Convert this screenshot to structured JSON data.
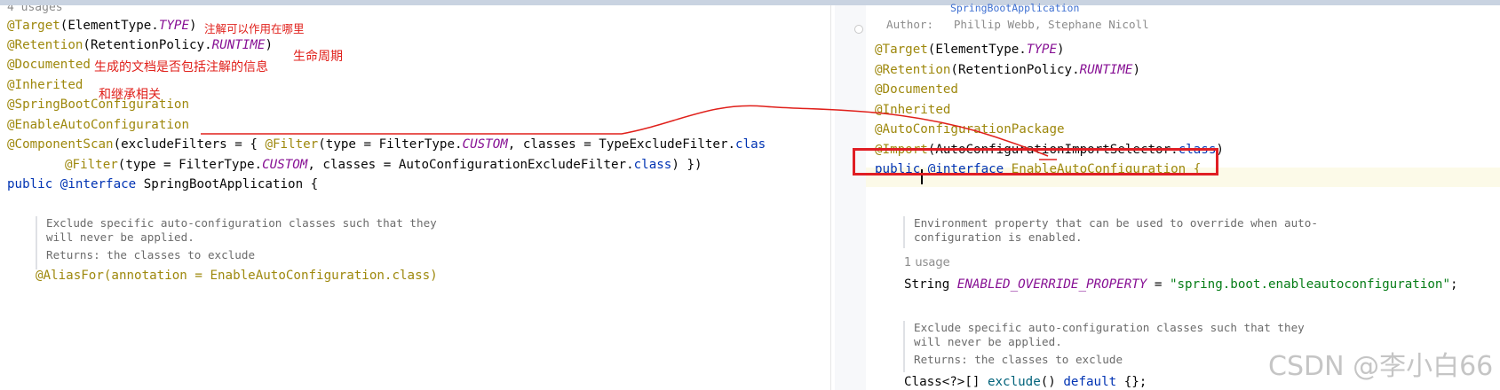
{
  "left": {
    "usages": "4 usages",
    "lines": {
      "target": {
        "ann": "@Target",
        "open": "(ElementType.",
        "const": "TYPE",
        "close": ")"
      },
      "retention": {
        "ann": "@Retention",
        "open": "(RetentionPolicy.",
        "const": "RUNTIME",
        "close": ")"
      },
      "documented": {
        "ann": "@Documented"
      },
      "inherited": {
        "ann": "@Inherited"
      },
      "sba": {
        "ann": "@SpringBootConfiguration"
      },
      "eac": {
        "ann": "@EnableAutoConfiguration"
      },
      "cs1": {
        "ann": "@ComponentScan",
        "a": "(excludeFilters = { ",
        "filter": "@Filter",
        "b": "(type = FilterType.",
        "const": "CUSTOM",
        "c": ", classes = TypeExcludeFilter.",
        "kw": "clas"
      },
      "cs2": {
        "filter": "@Filter",
        "b": "(type = FilterType.",
        "const": "CUSTOM",
        "c": ", classes = AutoConfigurationExcludeFilter.",
        "kw": "class",
        "d": ") })"
      },
      "decl": {
        "kw1": "public",
        "kw2": "@interface",
        "name": " SpringBootApplication {"
      },
      "alias": {
        "text": "@AliasFor(annotation = EnableAutoConfiguration.class)"
      }
    },
    "doc": {
      "l1": "Exclude specific auto-configuration classes such that they",
      "l2": "will never be applied.",
      "ret": "Returns: the classes to exclude"
    },
    "notes": {
      "target": "注解可以作用在哪里",
      "lifecycle": "生命周期",
      "documented": "生成的文档是否包括注解的信息",
      "inherited": "和继承相关"
    }
  },
  "right": {
    "since_link": "SpringBootApplication",
    "author_label": "Author:",
    "author_names": "Phillip Webb, Stephane Nicoll",
    "lines": {
      "target": {
        "ann": "@Target",
        "open": "(ElementType.",
        "const": "TYPE",
        "close": ")"
      },
      "retention": {
        "ann": "@Retention",
        "open": "(RetentionPolicy.",
        "const": "RUNTIME",
        "close": ")"
      },
      "documented": {
        "ann": "@Documented"
      },
      "inherited": {
        "ann": "@Inherited"
      },
      "acp": {
        "ann": "@AutoConfigurationPackage"
      },
      "import": {
        "ann": "@Import",
        "open": "(AutoConfigurationImportSelector.",
        "kw": "class",
        "close": ")"
      },
      "decl": {
        "kw1": "public",
        "kw2": "@interface",
        "name": " EnableAutoConfiguration {"
      }
    },
    "doc1": {
      "l1": "Environment property that can be used to override when auto-",
      "l2": "configuration is enabled."
    },
    "usage": "1 usage",
    "field": {
      "type": "String ",
      "name": "ENABLED_OVERRIDE_PROPERTY",
      "eq": " = ",
      "value": "\"spring.boot.enableautoconfiguration\"",
      "end": ";"
    },
    "doc2": {
      "l1": "Exclude specific auto-configuration classes such that they",
      "l2": "will never be applied.",
      "ret": "Returns: the classes to exclude"
    },
    "method": {
      "type": "Class<?>[] ",
      "name": "exclude",
      "rest": "() ",
      "kw": "default",
      "end": " {};"
    }
  },
  "watermark": "CSDN @李小白66",
  "colors": {
    "annotation_note": "#e0201b",
    "highlight_box": "#e01e24",
    "annotation": "#9e880d",
    "keyword": "#0033b3",
    "constant": "#871094",
    "string": "#067d17"
  }
}
